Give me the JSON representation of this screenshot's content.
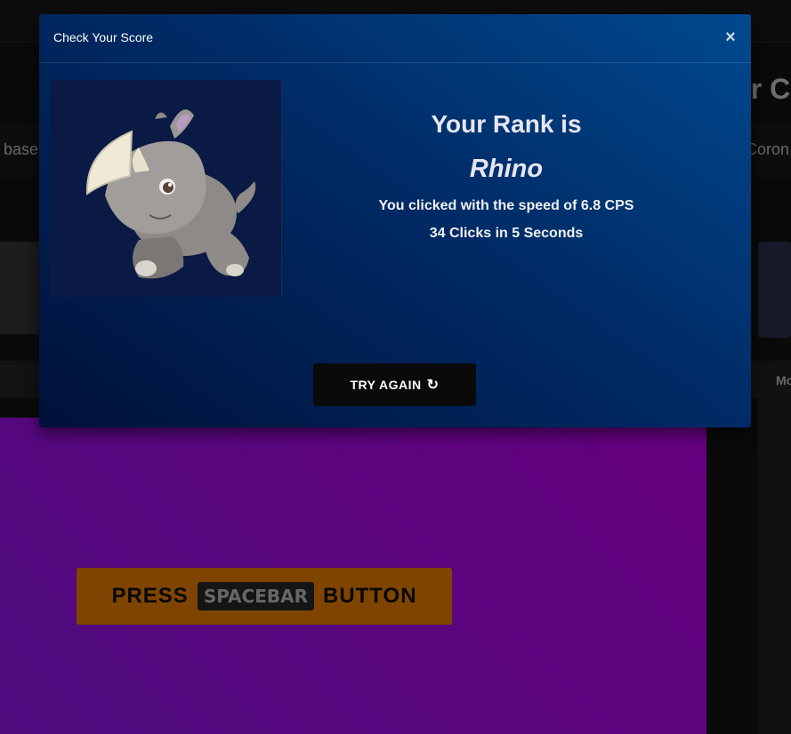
{
  "background": {
    "title_fragment": "ar C",
    "desc_left_fragment": "base",
    "desc_right_fragment": "Coron",
    "tab_fragment": "Mo",
    "press_button": {
      "prefix": "PRESS",
      "key_label": "SPACEBAR",
      "suffix": "BUTTON"
    }
  },
  "modal": {
    "title": "Check Your Score",
    "close_label": "×",
    "rank_heading": "Your Rank is",
    "rank_name": "Rhino",
    "speed_line": "You clicked with the speed of 6.8 CPS",
    "clicks_line": "34 Clicks in 5 Seconds",
    "try_again_label": "TRY AGAIN",
    "try_again_icon": "refresh-icon",
    "rank_image": "rhino-illustration"
  },
  "colors": {
    "modal_gradient_start": "#00498f",
    "modal_gradient_end": "#00113a",
    "game_area_start": "#cc00ff",
    "game_area_end": "#9d18ff",
    "press_button_bg": "#ff8a00",
    "try_again_bg": "#0a0a0a"
  }
}
